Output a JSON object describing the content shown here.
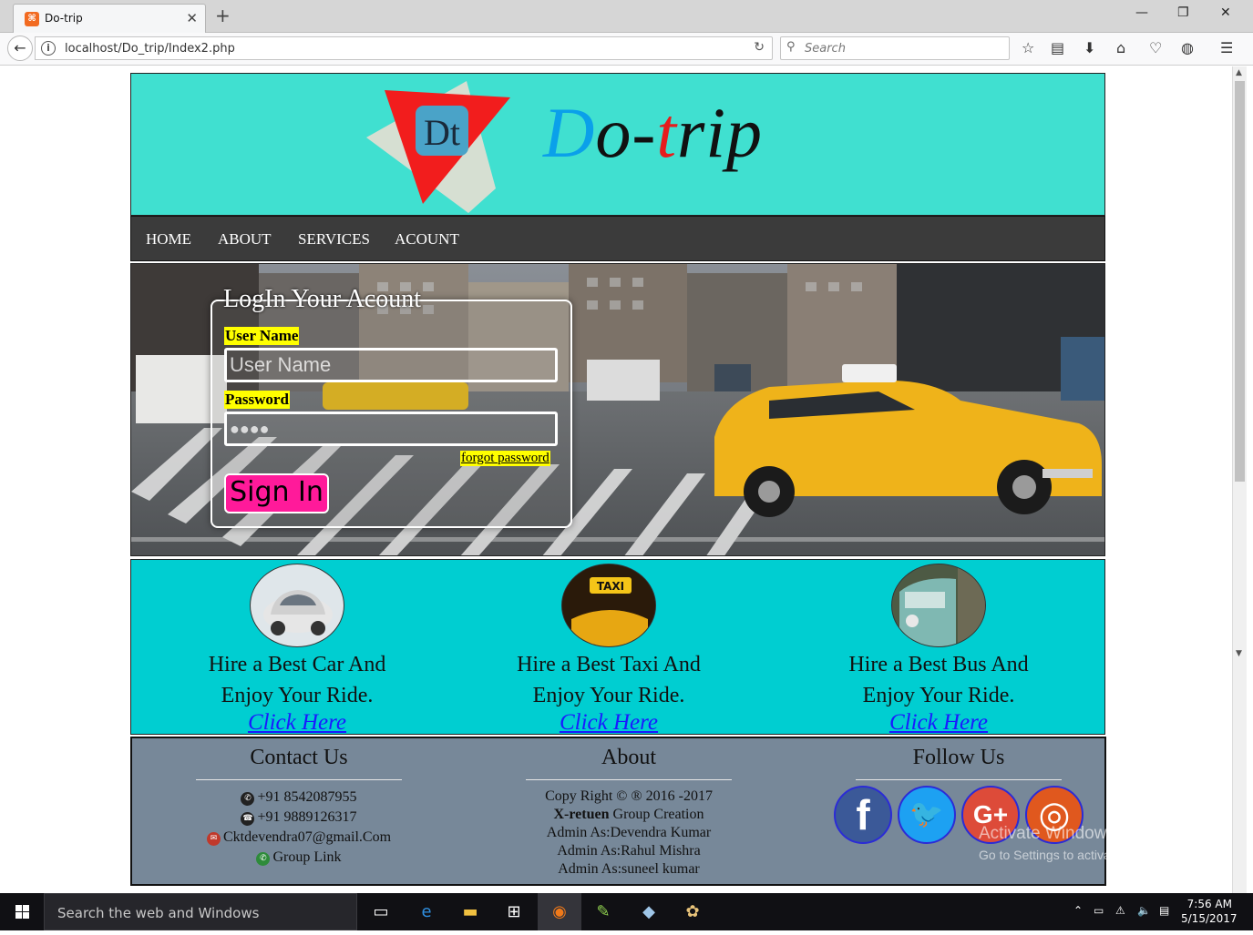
{
  "browser": {
    "tab_title": "Do-trip",
    "tab_favicon_text": "⌘",
    "new_tab": "+",
    "url": "localhost/Do_trip/Index2.php",
    "search_placeholder": "Search",
    "window_controls": {
      "minimize": "—",
      "restore": "❐",
      "close": "✕"
    }
  },
  "site": {
    "logo_letters": "Dt",
    "brand_first": "D",
    "brand_mid": "o-",
    "brand_t": "t",
    "brand_end": "rip",
    "menu": [
      "HOME",
      "ABOUT",
      "SERVICES",
      "ACOUNT"
    ],
    "login": {
      "legend": "LogIn Your Acount",
      "username_label": "User Name",
      "username_placeholder": "User Name",
      "password_label": "Password",
      "password_mask": "●●●●",
      "forgot": "forgot password",
      "signin": "Sign In"
    },
    "services": [
      {
        "line1": "Hire a Best Car And",
        "line2": "Enjoy Your Ride.",
        "link": "Click Here"
      },
      {
        "line1": "Hire a Best Taxi And",
        "line2": "Enjoy Your Ride.",
        "link": "Click Here"
      },
      {
        "line1": "Hire a Best Bus And",
        "line2": "Enjoy Your Ride.",
        "link": "Click Here"
      }
    ],
    "footer": {
      "contact_heading": "Contact Us",
      "contact": [
        "+91 8542087955",
        "+91 9889126317",
        "Cktdevendra07@gmail.Com",
        "Group Link"
      ],
      "about_heading": "About",
      "copyright": "Copy Right © ® 2016 -2017",
      "group_bold": "X-retuen",
      "group_rest": " Group Creation",
      "admins": [
        "Admin As:Devendra Kumar",
        "Admin As:Rahul Mishra",
        "Admin As:suneel kumar"
      ],
      "follow_heading": "Follow Us",
      "social": [
        {
          "name": "facebook",
          "glyph": "f",
          "color": "#3b5998"
        },
        {
          "name": "twitter",
          "glyph": "🐦",
          "color": "#1da1f2"
        },
        {
          "name": "google-plus",
          "glyph": "G+",
          "color": "#dd4b39"
        },
        {
          "name": "instagram",
          "glyph": "◎",
          "color": "#e0581e"
        }
      ]
    }
  },
  "watermark": {
    "title": "Activate Windows",
    "subtitle": "Go to Settings to activate Windows."
  },
  "taskbar": {
    "search_text": "Search the web and Windows",
    "time": "7:56 AM",
    "date": "5/15/2017"
  }
}
